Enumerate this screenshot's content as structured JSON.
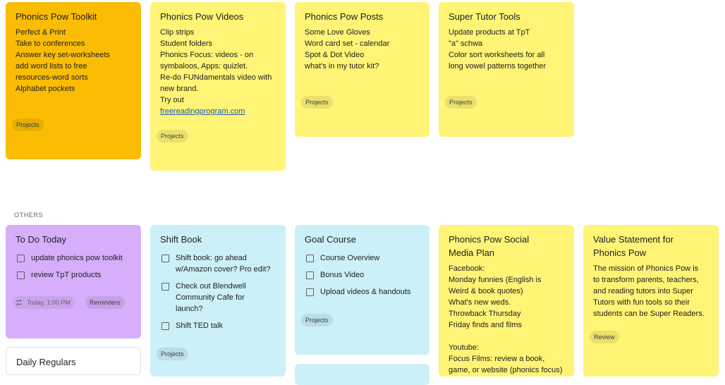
{
  "pinned": [
    {
      "title": "Phonics Pow Toolkit",
      "lines": [
        "Perfect & Print",
        "Take to conferences",
        "Answer key set-worksheets",
        "add word lists to free",
        "resources-word sorts",
        "Alphabet pockets"
      ],
      "label": "Projects",
      "color": "#fbbc04"
    },
    {
      "title": "Phonics Pow Videos",
      "lines": [
        "Clip strips",
        "Student folders",
        "Phonics Focus: videos - on",
        "symbaloos, Apps: quizlet.",
        "Re-do FUNdamentals video with",
        "new brand.",
        "Try out"
      ],
      "link": "freereadingprogram.com",
      "label": "Projects",
      "color": "#fff475"
    },
    {
      "title": "Phonics Pow Posts",
      "lines": [
        "Some Love Gloves",
        "Word card set - calendar",
        "Spot & Dot Video",
        "what's in my tutor kit?"
      ],
      "label": "Projects",
      "color": "#fff475"
    },
    {
      "title": "Super Tutor Tools",
      "lines": [
        "Update products at TpT",
        "\"a\" schwa",
        "Color sort worksheets for all",
        "long vowel patterns together"
      ],
      "label": "Projects",
      "color": "#fff475"
    }
  ],
  "others_heading": "OTHERS",
  "others": {
    "todo_today": {
      "title": "To Do Today",
      "items": [
        "update phonics pow toolkit",
        "review TpT products"
      ],
      "reminder": "Today, 1:00 PM",
      "label": "Reminders"
    },
    "daily_regulars": {
      "title": "Daily Regulars"
    },
    "shift_book": {
      "title": "Shift Book",
      "items": [
        [
          "Shift book: go ahead",
          "w/Amazon cover? Pro edit?"
        ],
        [
          "Check out Blendwell",
          "Community Cafe for",
          "launch?"
        ],
        [
          "Shift TED talk"
        ]
      ],
      "label": "Projects"
    },
    "goal_course": {
      "title": "Goal Course",
      "items": [
        "Course Overview",
        "Bonus Video",
        "Upload videos & handouts"
      ],
      "label": "Projects"
    },
    "social_media": {
      "title": [
        "Phonics Pow Social",
        "Media Plan"
      ],
      "lines": [
        "Facebook:",
        "Monday funnies (English is",
        "Weird & book quotes)",
        "What's new weds.",
        "Throwback Thursday",
        "Friday finds and films",
        "",
        "Youtube:",
        "Focus Films: review a book,",
        "game, or website (phonics focus)"
      ]
    },
    "value_statement": {
      "title": [
        "Value Statement for",
        "Phonics Pow"
      ],
      "lines": [
        "The mission of Phonics Pow is",
        "to transform parents, teachers,",
        "and reading tutors into Super",
        "Tutors with fun tools so their",
        "students can be Super Readers."
      ],
      "label": "Review"
    }
  }
}
